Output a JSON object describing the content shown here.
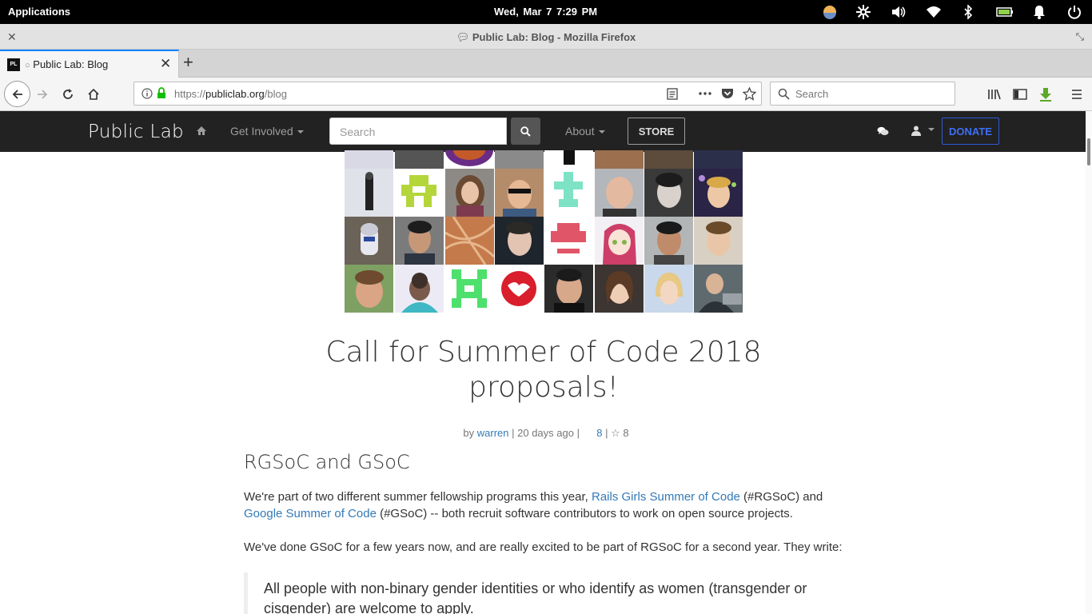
{
  "system_bar": {
    "applications": "Applications",
    "datetime": "Wed, Mar 7   7:29 PM"
  },
  "window": {
    "title": "Public Lab: Blog - Mozilla Firefox"
  },
  "tabs": [
    {
      "label": "Public Lab: Blog",
      "favicon_text": "PL"
    }
  ],
  "toolbar": {
    "url_prefix": "https://",
    "url_domain": "publiclab.org",
    "url_path": "/blog",
    "search_placeholder": "Search"
  },
  "site": {
    "brand": "Public Lab",
    "nav_get_involved": "Get Involved",
    "search_placeholder": "Search",
    "nav_about": "About",
    "store_label": "STORE",
    "donate_label": "DONATE"
  },
  "post": {
    "title": "Call for Summer of Code 2018 proposals!",
    "by": "by",
    "author": "warren",
    "time": " | 20 days ago | ",
    "comments": "8",
    "likes": "8",
    "heading": "RGSoC and GSoC",
    "p1_pre": "We're part of two different summer fellowship programs this year, ",
    "p1_link1": "Rails Girls Summer of Code",
    "p1_mid": " (#RGSoC) and ",
    "p1_link2": "Google Summer of Code",
    "p1_post": " (#GSoC) -- both recruit software contributors to work on open source projects.",
    "p2": "We've done GSoC for a few years now, and are really excited to be part of RGSoC for a second year. They write:",
    "quote": "All people with non-binary gender identities or who identify as women (transgender or cisgender) are welcome to apply."
  },
  "colors": {
    "link": "#337ab7",
    "navbar": "#222222",
    "donate": "#3d6ef5",
    "tab_accent": "#0a84ff"
  }
}
